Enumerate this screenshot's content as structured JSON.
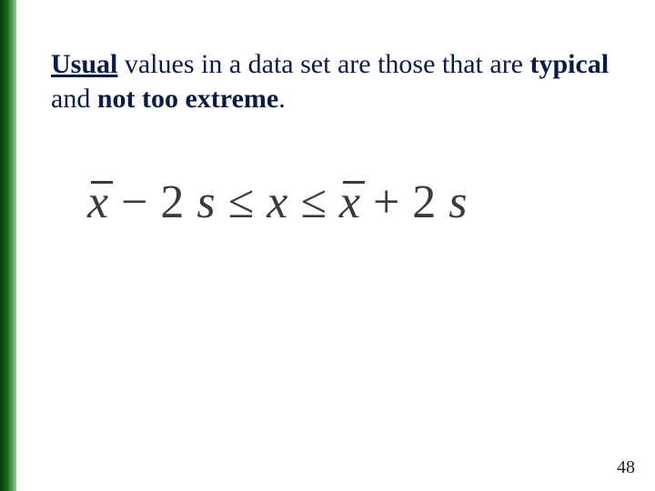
{
  "heading": {
    "word_underlined": "Usual",
    "seg1": " values in a data set are those that are ",
    "bold1": "typical",
    "seg2": " and ",
    "bold2": "not too extreme",
    "seg3": "."
  },
  "formula": {
    "lhs_var": "x",
    "minus": "−",
    "coef": "2",
    "s": "s",
    "le1": "≤",
    "mid_var": "x",
    "le2": "≤",
    "rhs_var": "x",
    "plus": "+"
  },
  "page_number": "48"
}
